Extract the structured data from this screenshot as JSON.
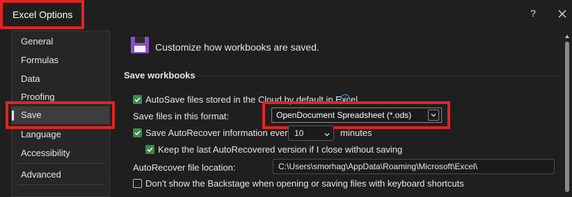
{
  "window": {
    "title": "Excel Options",
    "help_label": "?",
    "close_icon": "close-icon"
  },
  "sidebar": {
    "items": [
      {
        "label": "General"
      },
      {
        "label": "Formulas"
      },
      {
        "label": "Data"
      },
      {
        "label": "Proofing"
      },
      {
        "label": "Save"
      },
      {
        "label": "Language"
      },
      {
        "label": "Accessibility"
      },
      {
        "label": "Advanced"
      }
    ],
    "active": "Save"
  },
  "main": {
    "header_icon": "save-icon",
    "header_text": "Customize how workbooks are saved.",
    "section_title": "Save workbooks",
    "autosave_label": "AutoSave files stored in the Cloud by default in Excel",
    "format_label": "Save files in this format:",
    "format_value": "OpenDocument Spreadsheet (*.ods)",
    "autorecover_label": "Save AutoRecover information every",
    "autorecover_minutes": "10",
    "minutes_label": "minutes",
    "keep_label": "Keep the last AutoRecovered version if I close without saving",
    "location_label": "AutoRecover file location:",
    "location_value": "C:\\Users\\smorhag\\AppData\\Roaming\\Microsoft\\Excel\\",
    "backstage_label": "Don't show the Backstage when opening or saving files with keyboard shortcuts"
  },
  "colors": {
    "background": "#1f1f1f",
    "checkbox_accent": "#3c8a4e",
    "annotation_red": "#e32323",
    "save_icon_purple": "#8a4fc9"
  }
}
